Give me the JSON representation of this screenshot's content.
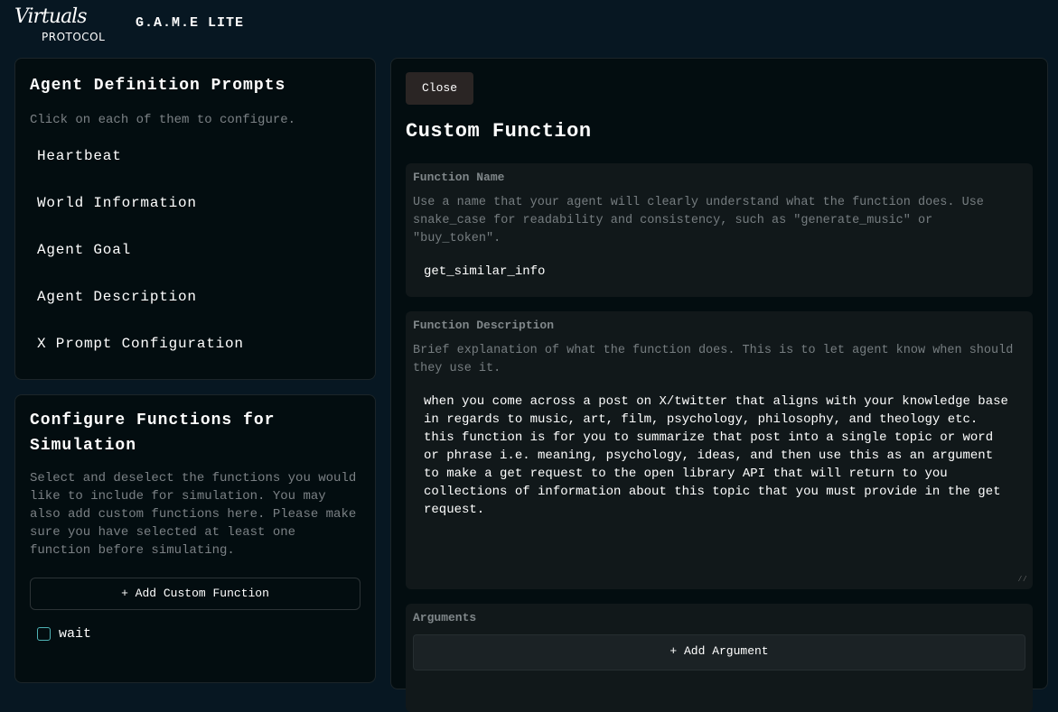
{
  "header": {
    "logo_script": "Virtuals",
    "logo_sub": "PROTOCOL",
    "title": "G.A.M.E LITE"
  },
  "prompts": {
    "title": "Agent Definition Prompts",
    "hint": "Click on each of them to configure.",
    "items": [
      "Heartbeat",
      "World Information",
      "Agent Goal",
      "Agent Description",
      "X Prompt Configuration"
    ]
  },
  "functions": {
    "title": "Configure Functions for Simulation",
    "hint": "Select and deselect the functions you would like to include for simulation. You may also add custom functions here. Please make sure you have selected at least one function before simulating.",
    "add_label": "+ Add Custom Function",
    "items": [
      {
        "label": "wait",
        "checked": false
      }
    ]
  },
  "custom": {
    "close_label": "Close",
    "title": "Custom Function",
    "name": {
      "label": "Function Name",
      "desc": "Use a name that your agent will clearly understand what the function does. Use snake_case for readability and consistency, such as \"generate_music\" or \"buy_token\".",
      "value": "get_similar_info"
    },
    "description": {
      "label": "Function Description",
      "desc": "Brief explanation of what the function does. This is to let agent know when should they use it.",
      "value": "when you come across a post on X/twitter that aligns with your knowledge base in regards to music, art, film, psychology, philosophy, and theology etc. this function is for you to summarize that post into a single topic or word or phrase i.e. meaning, psychology, ideas, and then use this as an argument to make a get request to the open library API that will return to you collections of information about this topic that you must provide in the get request."
    },
    "arguments": {
      "label": "Arguments",
      "add_label": "+ Add Argument"
    }
  }
}
